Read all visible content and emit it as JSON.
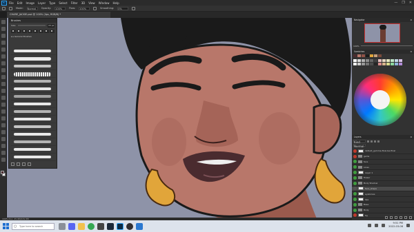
{
  "app": {
    "logo_text": "Ps",
    "window_controls": [
      "—",
      "❐",
      "✕"
    ]
  },
  "menu": {
    "items": [
      "File",
      "Edit",
      "Image",
      "Layer",
      "Type",
      "Select",
      "Filter",
      "3D",
      "View",
      "Window",
      "Help"
    ]
  },
  "options_bar": {
    "mode_label": "Mode:",
    "mode_value": "Normal",
    "opacity_label": "Opacity:",
    "opacity_value": "100%",
    "flow_label": "Flow:",
    "flow_value": "100%",
    "smoothing_label": "Smoothing:",
    "smoothing_value": "0%"
  },
  "document": {
    "tab_title": "CHARE_JACKIE.psd @ 100% (lips, RGB/8) *"
  },
  "brushes_panel": {
    "title": "Brushes",
    "size_label": "Size:",
    "size_value": "15 px",
    "folder_label": "▸ ▸ General Brushes"
  },
  "navigator_panel": {
    "title": "Navigator",
    "zoom_value": "100%"
  },
  "swatches_panel": {
    "title": "Swatches"
  },
  "layers_panel": {
    "title": "Layers",
    "kind_label": "Kind",
    "blend_label": "Normal",
    "rows": [
      {
        "name": "default_gamma-final-bw-final",
        "eye": "red",
        "kind": "layer",
        "selected": false
      },
      {
        "name": "gems",
        "eye": "red",
        "kind": "folder",
        "selected": false
      },
      {
        "name": "face",
        "eye": "green",
        "kind": "folder",
        "selected": false
      },
      {
        "name": "Lines",
        "eye": "green",
        "kind": "folder",
        "selected": false
      },
      {
        "name": "Layer 1",
        "eye": "green",
        "kind": "layer",
        "selected": false
      },
      {
        "name": "flower",
        "eye": "green",
        "kind": "folder",
        "selected": false
      },
      {
        "name": "Body Shadow",
        "eye": "green",
        "kind": "folder",
        "selected": false
      },
      {
        "name": "face_shape",
        "eye": "none",
        "kind": "layer",
        "selected": true
      },
      {
        "name": "eyebrows",
        "eye": "green",
        "kind": "layer",
        "selected": false
      },
      {
        "name": "lips",
        "eye": "green",
        "kind": "layer",
        "selected": false
      },
      {
        "name": "Base",
        "eye": "green",
        "kind": "folder",
        "selected": false
      },
      {
        "name": "Body",
        "eye": "green",
        "kind": "folder",
        "selected": false
      },
      {
        "name": "bg",
        "eye": "red",
        "kind": "layer",
        "selected": false
      }
    ]
  },
  "status_bar": {
    "zoom": "100%",
    "doc_info": "Doc: 25.9M/131.5M"
  },
  "taskbar": {
    "search_placeholder": "Type here to search",
    "time": "9:51 PM",
    "date": "2022-03-08"
  },
  "colors": {
    "canvas_bg": "#8e93a8",
    "skin": "#b8776a",
    "skin_shadow": "#8f5146",
    "hair": "#1a1a1a",
    "lips": "#4a2b2f",
    "gold": "#e1a53a",
    "accent": "#31a8ff"
  }
}
